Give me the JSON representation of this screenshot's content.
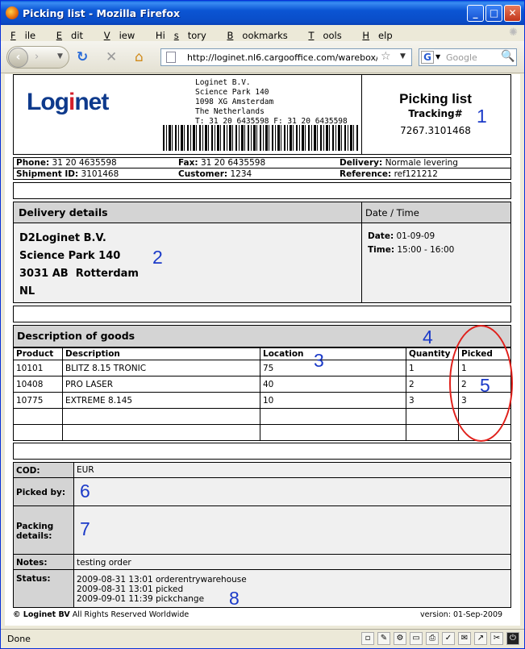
{
  "window": {
    "title": "Picking list - Mozilla Firefox"
  },
  "menu": [
    "File",
    "Edit",
    "View",
    "History",
    "Bookmarks",
    "Tools",
    "Help"
  ],
  "menu_underline": [
    "F",
    "E",
    "V",
    "s",
    "B",
    "T",
    "H"
  ],
  "nav": {
    "url": "http://loginet.nl6.cargooffice.com/warebox/picki",
    "search_placeholder": "Google"
  },
  "status": {
    "text": "Done"
  },
  "header": {
    "logo_pre": "Log",
    "logo_i": "i",
    "logo_post": "net",
    "address": "Loginet B.V.\nScience Park 140\n1098 XG Amsterdam\nThe Netherlands\nT: 31 20 6435598 F: 31 20 6435598",
    "title": "Picking list",
    "tracking_label": "Tracking#",
    "tracking_number": "7267.3101468"
  },
  "info": {
    "phone_label": "Phone:",
    "phone": "31 20 4635598",
    "fax_label": "Fax:",
    "fax": "31 20 6435598",
    "delivery_label": "Delivery:",
    "delivery": "Normale levering",
    "shipment_label": "Shipment ID:",
    "shipment": "3101468",
    "customer_label": "Customer:",
    "customer": "1234",
    "reference_label": "Reference:",
    "reference": "ref121212"
  },
  "delivery": {
    "heading": "Delivery details",
    "datetime_heading": "Date / Time",
    "address_lines": [
      "D2Loginet B.V.",
      "Science Park 140",
      "3031 AB  Rotterdam",
      "NL"
    ],
    "date_label": "Date:",
    "date": "01-09-09",
    "time_label": "Time:",
    "time": "15:00 - 16:00"
  },
  "goods": {
    "heading": "Description of goods",
    "columns": [
      "Product",
      "Description",
      "Location",
      "Quantity",
      "Picked"
    ],
    "rows": [
      [
        "10101",
        "BLITZ 8.15 TRONIC",
        "75",
        "1",
        "1"
      ],
      [
        "10408",
        "PRO LASER",
        "40",
        "2",
        "2"
      ],
      [
        "10775",
        "EXTREME 8.145",
        "10",
        "3",
        "3"
      ],
      [
        "",
        "",
        "",
        "",
        ""
      ],
      [
        "",
        "",
        "",
        "",
        ""
      ]
    ]
  },
  "footer_fields": {
    "cod_label": "COD:",
    "cod": "EUR",
    "picked_by_label": "Picked by:",
    "packing_label_1": "Packing",
    "packing_label_2": "details:",
    "notes_label": "Notes:",
    "notes": "testing order",
    "status_label": "Status:",
    "status_lines": [
      "2009-08-31 13:01 orderentrywarehouse",
      "2009-08-31 13:01 picked",
      "2009-09-01 11:39 pickchange"
    ]
  },
  "copyright": {
    "bold": "© Loginet BV",
    "rest": " All Rights Reserved Worldwide",
    "version": "version: 01-Sep-2009"
  },
  "annotations": [
    "1",
    "2",
    "3",
    "4",
    "5",
    "6",
    "7",
    "8"
  ]
}
